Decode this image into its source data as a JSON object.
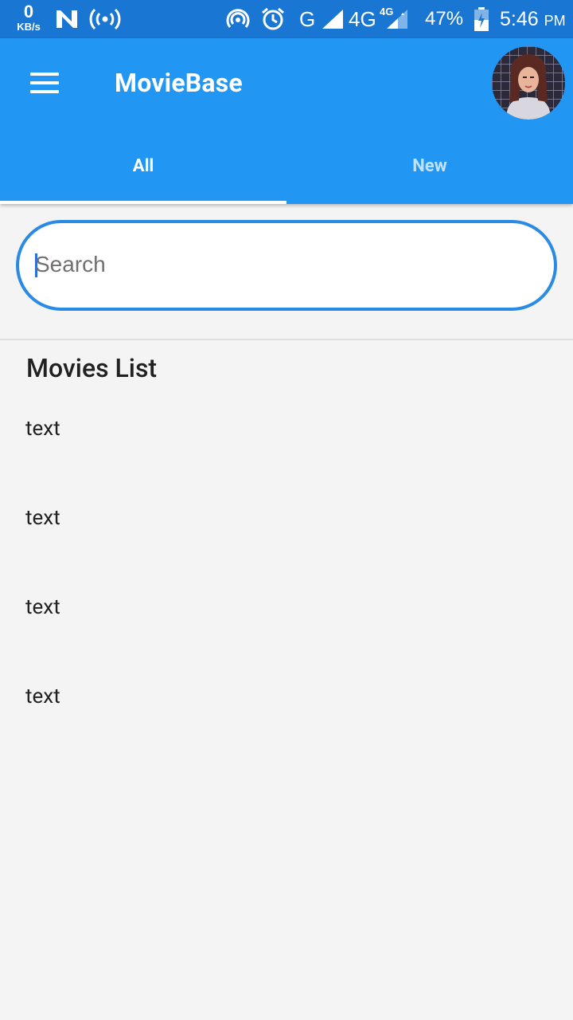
{
  "status_bar": {
    "speed_value": "0",
    "speed_unit": "KB/s",
    "network_g": "G",
    "network_4g": "4G",
    "network_4g_small": "4G",
    "battery": "47%",
    "time": "5:46",
    "ampm": "PM",
    "icons": [
      "notification-n-icon",
      "hotspot-icon",
      "nfc-icon",
      "alarm-icon",
      "signal-icon",
      "signal-icon",
      "battery-charging-icon"
    ]
  },
  "app_bar": {
    "title": "MovieBase",
    "menu_icon": "hamburger-menu-icon",
    "avatar": "profile-avatar"
  },
  "tabs": [
    {
      "label": "All",
      "active": true
    },
    {
      "label": "New",
      "active": false
    }
  ],
  "search": {
    "placeholder": "Search",
    "value": ""
  },
  "section": {
    "title": "Movies List"
  },
  "movies": [
    {
      "label": "text"
    },
    {
      "label": "text"
    },
    {
      "label": "text"
    },
    {
      "label": "text"
    }
  ],
  "colors": {
    "status_bar": "#1976d2",
    "app_bar": "#2196f3",
    "search_border": "#2a8be6",
    "background": "#f4f4f4"
  }
}
